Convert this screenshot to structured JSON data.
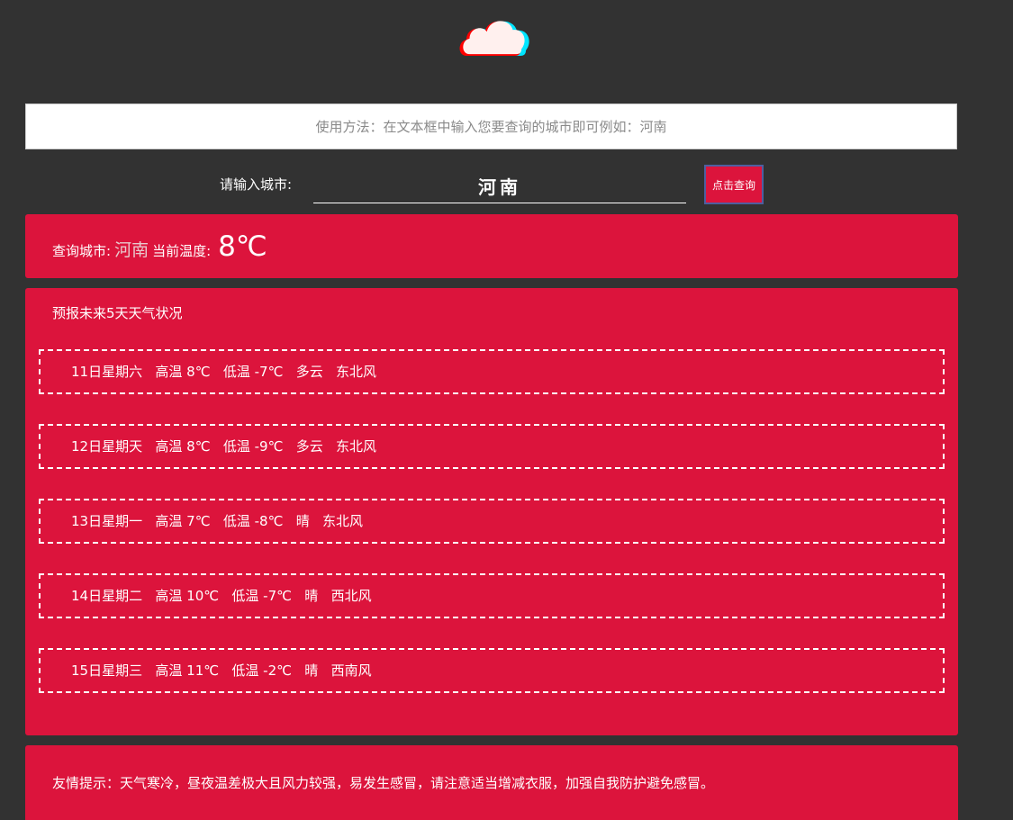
{
  "usage": {
    "text": "使用方法：在文本框中输入您要查询的城市即可例如：河南"
  },
  "search": {
    "label": "请输入城市:",
    "value": "河南",
    "button_label": "点击查询"
  },
  "current": {
    "city_label": "查询城市:",
    "city": "河南",
    "temp_label": "当前温度:",
    "temperature": "8℃"
  },
  "forecast": {
    "title": "预报未来5天天气状况",
    "days": [
      {
        "text": "11日星期六   高温 8℃   低温 -7℃   多云   东北风"
      },
      {
        "text": "12日星期天   高温 8℃   低温 -9℃   多云   东北风"
      },
      {
        "text": "13日星期一   高温 7℃   低温 -8℃   晴   东北风"
      },
      {
        "text": "14日星期二   高温 10℃   低温 -7℃   晴   西北风"
      },
      {
        "text": "15日星期三   高温 11℃   低温 -2℃   晴   西南风"
      }
    ]
  },
  "tip": {
    "text": "友情提示：天气寒冷，昼夜温差极大且风力较强，易发生感冒，请注意适当增减衣服，加强自我防护避免感冒。"
  },
  "colors": {
    "background": "#323232",
    "accent": "#dc143c",
    "logo_left": "#ff0000",
    "logo_right": "#00e5ff",
    "logo_fill": "#fff0ee"
  },
  "icons": {
    "logo": "cloud-icon"
  }
}
